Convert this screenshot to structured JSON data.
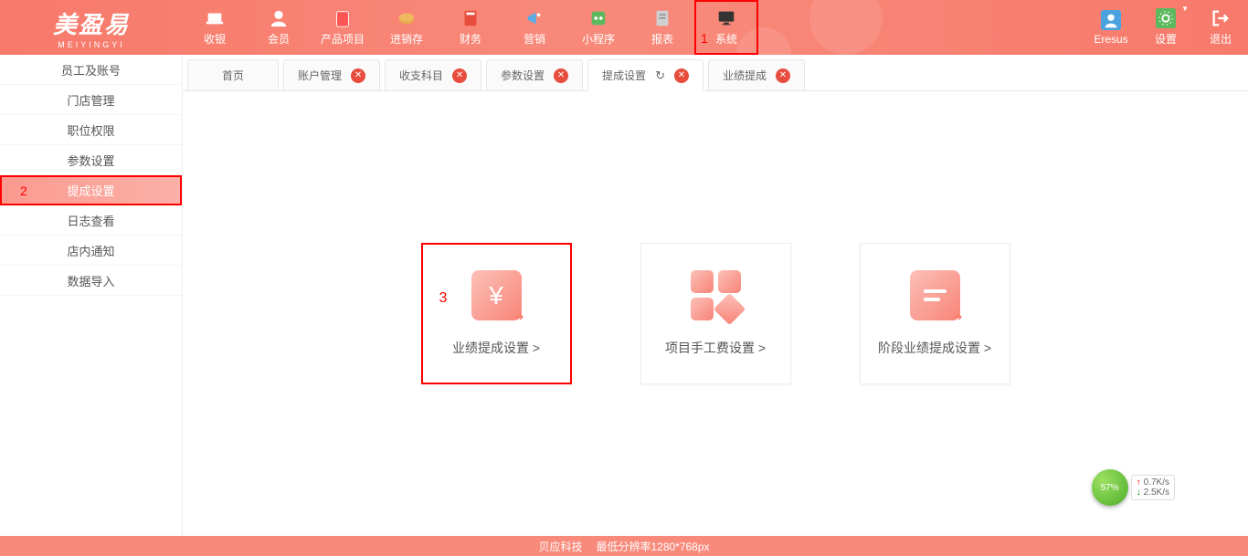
{
  "logo": {
    "main": "美盈易",
    "sub": "MEIYINGYI"
  },
  "nav": [
    {
      "label": "收银",
      "icon": "cashier"
    },
    {
      "label": "会员",
      "icon": "member"
    },
    {
      "label": "产品项目",
      "icon": "product"
    },
    {
      "label": "进销存",
      "icon": "inventory"
    },
    {
      "label": "财务",
      "icon": "finance"
    },
    {
      "label": "营销",
      "icon": "marketing"
    },
    {
      "label": "小程序",
      "icon": "miniapp"
    },
    {
      "label": "报表",
      "icon": "report"
    },
    {
      "label": "系统",
      "icon": "system",
      "highlighted": true,
      "annotation": "1"
    }
  ],
  "navRight": [
    {
      "label": "Eresus",
      "icon": "user"
    },
    {
      "label": "设置",
      "icon": "settings"
    },
    {
      "label": "退出",
      "icon": "exit"
    }
  ],
  "sidebar": [
    {
      "label": "员工及账号"
    },
    {
      "label": "门店管理"
    },
    {
      "label": "职位权限"
    },
    {
      "label": "参数设置"
    },
    {
      "label": "提成设置",
      "active": true,
      "annotation": "2"
    },
    {
      "label": "日志查看"
    },
    {
      "label": "店内通知"
    },
    {
      "label": "数据导入"
    }
  ],
  "tabs": [
    {
      "label": "首页",
      "home": true
    },
    {
      "label": "账户管理",
      "closable": true
    },
    {
      "label": "收支科目",
      "closable": true
    },
    {
      "label": "参数设置",
      "closable": true
    },
    {
      "label": "提成设置",
      "active": true,
      "refresh": true,
      "closable": true
    },
    {
      "label": "业绩提成",
      "closable": true
    }
  ],
  "cards": [
    {
      "label": "业绩提成设置 >",
      "icon": "perf",
      "highlighted": true,
      "annotation": "3"
    },
    {
      "label": "项目手工费设置 >",
      "icon": "proj"
    },
    {
      "label": "阶段业绩提成设置 >",
      "icon": "stage"
    }
  ],
  "footer": {
    "company": "贝应科技",
    "resolution": "最低分辨率1280*768px"
  },
  "network": {
    "percent": "57%",
    "up": "0.7K/s",
    "down": "2.5K/s"
  }
}
